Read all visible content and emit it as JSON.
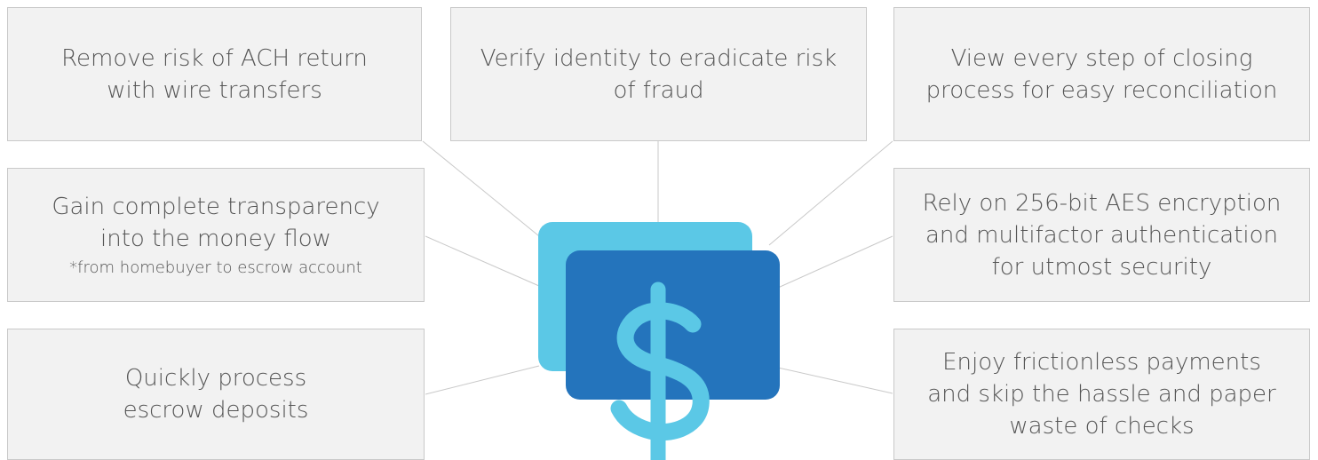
{
  "boxes": {
    "ach": {
      "lines": [
        "Remove risk of ACH return",
        "with wire transfers"
      ]
    },
    "identity": {
      "lines": [
        "Verify identity to eradicate risk",
        "of fraud"
      ]
    },
    "reconcile": {
      "lines": [
        "View every step of closing",
        "process for easy reconciliation"
      ]
    },
    "transparency": {
      "lines": [
        "Gain complete transparency",
        "into the money flow"
      ],
      "note": "*from homebuyer to escrow account"
    },
    "encryption": {
      "lines": [
        "Rely on 256-bit AES encryption",
        "and multifactor authentication",
        "for utmost security"
      ]
    },
    "deposits": {
      "lines": [
        "Quickly process",
        "escrow deposits"
      ]
    },
    "payments": {
      "lines": [
        "Enjoy frictionless payments",
        "and skip the hassle and paper",
        "waste of checks"
      ]
    }
  },
  "icon": {
    "name": "dollar-cards-icon",
    "back_color": "#5bc8e6",
    "front_color": "#2474bc",
    "symbol_color": "#5bc8e6"
  },
  "connector_color": "#c9c9c9"
}
